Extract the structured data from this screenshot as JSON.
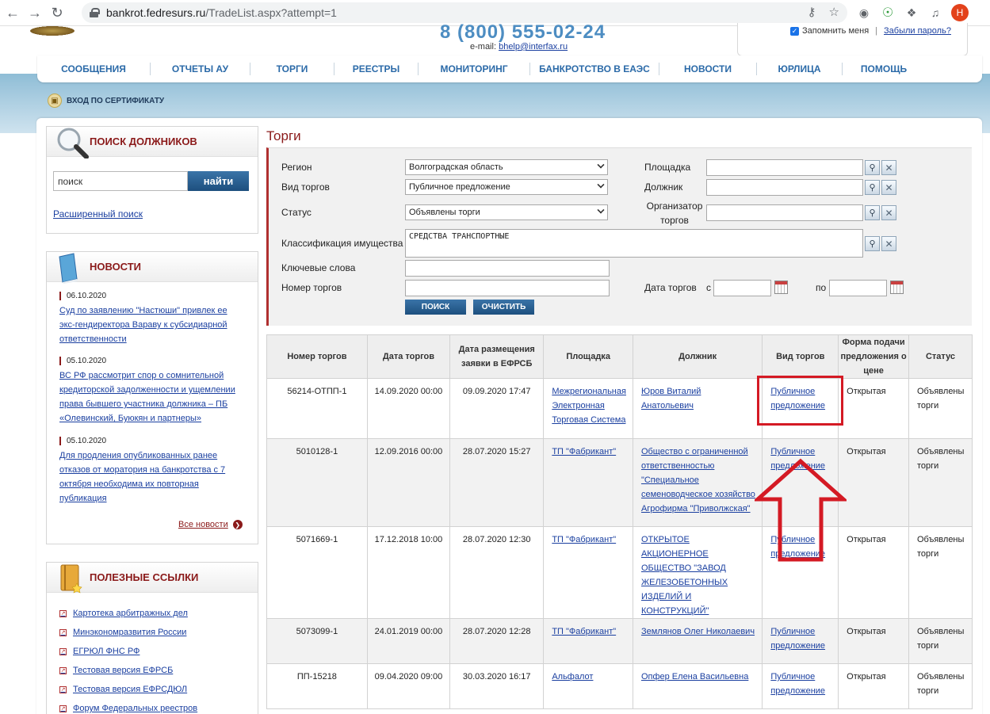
{
  "browser": {
    "url_host": "bankrot.fedresurs.ru",
    "url_path": "/TradeList.aspx?attempt=1",
    "avatar_letter": "Н"
  },
  "header": {
    "phone": "8 (800) 555-02-24",
    "email_label": "e-mail:",
    "email": "bhelp@interfax.ru",
    "remember_me": "Запомнить меня",
    "forgot_password": "Забыли пароль?"
  },
  "nav": [
    "СООБЩЕНИЯ",
    "ОТЧЕТЫ АУ",
    "ТОРГИ",
    "РЕЕСТРЫ",
    "МОНИТОРИНГ",
    "БАНКРОТСТВО В ЕАЭС",
    "НОВОСТИ",
    "ЮРЛИЦА",
    "ПОМОЩЬ"
  ],
  "cert_login": "ВХОД ПО СЕРТИФИКАТУ",
  "debtor_search": {
    "title": "ПОИСК ДОЛЖНИКОВ",
    "input_value": "поиск",
    "button": "найти",
    "advanced": "Расширенный поиск"
  },
  "news": {
    "title": "НОВОСТИ",
    "items": [
      {
        "date": "06.10.2020",
        "text": "Суд по заявлению \"Настюши\" привлек ее экс-гендиректора Вараву к субсидиарной ответственности"
      },
      {
        "date": "05.10.2020",
        "text": "ВС РФ рассмотрит спор о сомнительной кредиторской задолженности и ущемлении права бывшего участника должника – ПБ «Олевинский, Буюкян и партнеры»"
      },
      {
        "date": "05.10.2020",
        "text": "Для продления опубликованных ранее отказов от моратория на банкротства с 7 октября необходима их повторная публикация"
      }
    ],
    "all_news": "Все новости"
  },
  "useful_links": {
    "title": "ПОЛЕЗНЫЕ ССЫЛКИ",
    "items": [
      "Картотека арбитражных дел",
      "Минэкономразвития России",
      "ЕГРЮЛ ФНС РФ",
      "Тестовая версия ЕФРСБ",
      "Тестовая версия ЕФРСДЮЛ",
      "Форум Федеральных реестров"
    ]
  },
  "trades": {
    "title": "Торги",
    "filter": {
      "region_label": "Регион",
      "region_value": "Волгоградская область",
      "type_label": "Вид торгов",
      "type_value": "Публичное предложение",
      "status_label": "Статус",
      "status_value": "Объявлены торги",
      "platform_label": "Площадка",
      "debtor_label": "Должник",
      "organizer_label": "Организатор торгов",
      "classification_label": "Классификация имущества",
      "classification_value": "СРЕДСТВА ТРАНСПОРТНЫЕ",
      "keywords_label": "Ключевые слова",
      "number_label": "Номер торгов",
      "date_label": "Дата торгов",
      "date_from": "с",
      "date_to": "по",
      "search_btn": "ПОИСК",
      "clear_btn": "ОЧИСТИТЬ"
    },
    "columns": [
      "Номер торгов",
      "Дата торгов",
      "Дата размещения заявки в ЕФРСБ",
      "Площадка",
      "Должник",
      "Вид торгов",
      "Форма подачи предложения о цене",
      "Статус"
    ],
    "rows": [
      {
        "number": "56214-ОТПП-1",
        "date": "14.09.2020 00:00",
        "posted": "09.09.2020 17:47",
        "platform": "Межрегиональная Электронная Торговая Система",
        "debtor": "Юров Виталий Анатольевич",
        "type": "Публичное предложение",
        "form": "Открытая",
        "status": "Объявлены торги"
      },
      {
        "number": "5010128-1",
        "date": "12.09.2016 00:00",
        "posted": "28.07.2020 15:27",
        "platform": "ТП \"Фабрикант\"",
        "debtor": "Общество с ограниченной ответственностью \"Специальное семеноводческое хозяйство Агрофирма \"Приволжская\"",
        "type": "Публичное предложение",
        "form": "Открытая",
        "status": "Объявлены торги"
      },
      {
        "number": "5071669-1",
        "date": "17.12.2018 10:00",
        "posted": "28.07.2020 12:30",
        "platform": "ТП \"Фабрикант\"",
        "debtor": "ОТКРЫТОЕ АКЦИОНЕРНОЕ ОБЩЕСТВО \"ЗАВОД ЖЕЛЕЗОБЕТОННЫХ ИЗДЕЛИЙ И КОНСТРУКЦИЙ\"",
        "type": "Публичное предложение",
        "form": "Открытая",
        "status": "Объявлены торги"
      },
      {
        "number": "5073099-1",
        "date": "24.01.2019 00:00",
        "posted": "28.07.2020 12:28",
        "platform": "ТП \"Фабрикант\"",
        "debtor": "Землянов Олег Николаевич",
        "type": "Публичное предложение",
        "form": "Открытая",
        "status": "Объявлены торги"
      },
      {
        "number": "ПП-15218",
        "date": "09.04.2020 09:00",
        "posted": "30.03.2020 16:17",
        "platform": "Альфалот",
        "debtor": "Опфер Елена Васильевна",
        "type": "Публичное предложение",
        "form": "Открытая",
        "status": "Объявлены торги"
      }
    ]
  }
}
